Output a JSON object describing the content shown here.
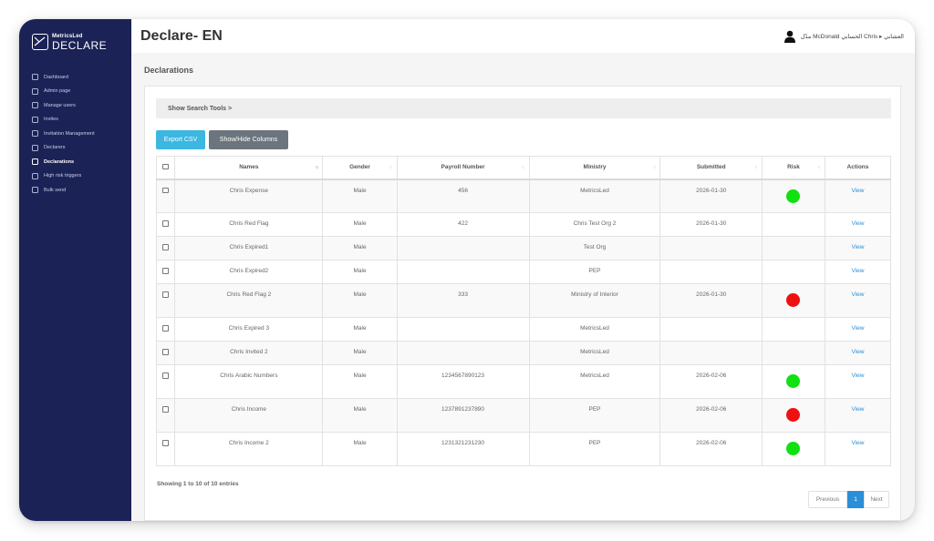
{
  "brand": {
    "top": "MetricsLed",
    "main": "DECLARE"
  },
  "sidebar": {
    "items": [
      {
        "label": "Dashboard",
        "icon": "dashboard-icon",
        "active": false
      },
      {
        "label": "Admin page",
        "icon": "admin-icon",
        "active": false
      },
      {
        "label": "Manage users",
        "icon": "users-icon",
        "active": false
      },
      {
        "label": "Invites",
        "icon": "invite-icon",
        "active": false
      },
      {
        "label": "Invitation Management",
        "icon": "building-icon",
        "active": false
      },
      {
        "label": "Declarers",
        "icon": "chat-icon",
        "active": false
      },
      {
        "label": "Declarations",
        "icon": "document-icon",
        "active": true
      },
      {
        "label": "High risk triggers",
        "icon": "shield-icon",
        "active": false
      },
      {
        "label": "Bulk send",
        "icon": "send-icon",
        "active": false
      }
    ]
  },
  "header": {
    "title": "Declare- EN",
    "user_name": "مدّل McDonald الحسابي Chris ▸ العشابي"
  },
  "section_title": "Declarations",
  "search_tools_label": "Show Search Tools >",
  "buttons": {
    "export": "Export CSV",
    "columns": "Show/Hide Columns"
  },
  "table": {
    "columns": [
      "Names",
      "Gender",
      "Payroll Number",
      "Ministry",
      "Submitted",
      "Risk",
      "Actions"
    ],
    "rows": [
      {
        "name": "Chris Expense",
        "gender": "Male",
        "payroll": "456",
        "ministry": "MetricsLed",
        "submitted": "2026-01-30",
        "risk": "green",
        "action": "View"
      },
      {
        "name": "Chris Red Flag",
        "gender": "Male",
        "payroll": "422",
        "ministry": "Chris Test Org 2",
        "submitted": "2026-01-30",
        "risk": "",
        "action": "View"
      },
      {
        "name": "Chris Expired1",
        "gender": "Male",
        "payroll": "",
        "ministry": "Test Org",
        "submitted": "",
        "risk": "",
        "action": "View"
      },
      {
        "name": "Chris Expired2",
        "gender": "Male",
        "payroll": "",
        "ministry": "PEP",
        "submitted": "",
        "risk": "",
        "action": "View"
      },
      {
        "name": "Chris Red Flag 2",
        "gender": "Male",
        "payroll": "333",
        "ministry": "Ministry of Interior",
        "submitted": "2026-01-30",
        "risk": "red",
        "action": "View"
      },
      {
        "name": "Chris Expired 3",
        "gender": "Male",
        "payroll": "",
        "ministry": "MetricsLed",
        "submitted": "",
        "risk": "",
        "action": "View"
      },
      {
        "name": "Chris Invited 2",
        "gender": "Male",
        "payroll": "",
        "ministry": "MetricsLed",
        "submitted": "",
        "risk": "",
        "action": "View"
      },
      {
        "name": "Chris Arabic Numbers",
        "gender": "Male",
        "payroll": "1234567890123",
        "ministry": "MetricsLed",
        "submitted": "2026-02-06",
        "risk": "green",
        "action": "View"
      },
      {
        "name": "Chris Income",
        "gender": "Male",
        "payroll": "1237891237890",
        "ministry": "PEP",
        "submitted": "2026-02-06",
        "risk": "red",
        "action": "View"
      },
      {
        "name": "Chris Income 2",
        "gender": "Male",
        "payroll": "1231321231230",
        "ministry": "PEP",
        "submitted": "2026-02-06",
        "risk": "green",
        "action": "View"
      }
    ]
  },
  "footer": {
    "info": "Showing 1 to 10 of 10 entries"
  },
  "pagination": {
    "previous": "Previous",
    "current": "1",
    "next": "Next"
  },
  "colors": {
    "sidebar_bg": "#1b2256",
    "accent": "#2a8fd8",
    "export_button": "#3bb7e0",
    "risk_green": "#11e011",
    "risk_red": "#ee1111"
  }
}
